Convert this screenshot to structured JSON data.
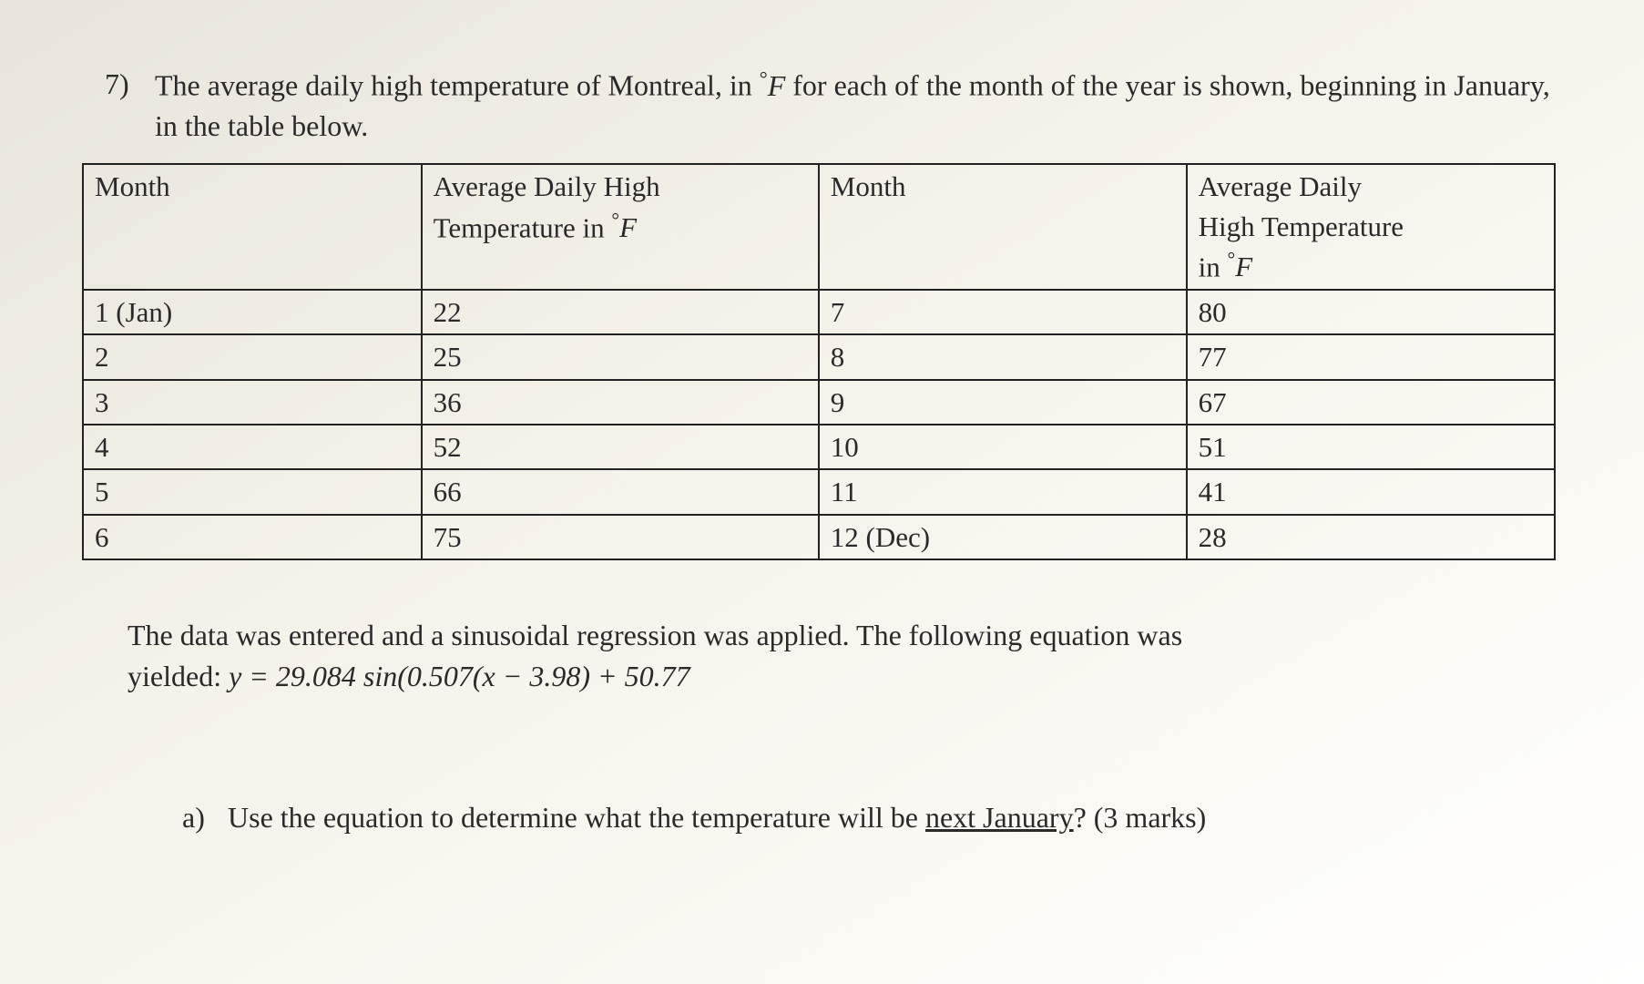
{
  "problem": {
    "number": "7)",
    "prompt_pre_unit": "The average daily high temperature of Montreal, in ",
    "unit_symbol": "°",
    "unit_letter": "F",
    "prompt_post_unit": " for each of the month of the year is shown, beginning in January, in the table below."
  },
  "table": {
    "headers": {
      "month1": "Month",
      "temp1_line1": "Average Daily High",
      "temp1_line2_pre": "Temperature in ",
      "temp1_unit_symbol": "°",
      "temp1_unit_letter": "F",
      "month2": "Month",
      "temp2_line1": "Average Daily",
      "temp2_line2": "High Temperature",
      "temp2_line3_pre": "in ",
      "temp2_unit_symbol": "°",
      "temp2_unit_letter": "F"
    },
    "rows": [
      {
        "m1": "1 (Jan)",
        "t1": "22",
        "m2": "7",
        "t2": "80"
      },
      {
        "m1": "2",
        "t1": "25",
        "m2": "8",
        "t2": "77"
      },
      {
        "m1": "3",
        "t1": "36",
        "m2": "9",
        "t2": "67"
      },
      {
        "m1": "4",
        "t1": "52",
        "m2": "10",
        "t2": "51"
      },
      {
        "m1": "5",
        "t1": "66",
        "m2": "11",
        "t2": "41"
      },
      {
        "m1": "6",
        "t1": "75",
        "m2": "12 (Dec)",
        "t2": "28"
      }
    ]
  },
  "regression": {
    "line1": "The data was entered and a sinusoidal regression was applied. The following equation was",
    "line2_prefix": "yielded:   ",
    "equation": "y = 29.084 sin(0.507(x − 3.98) + 50.77"
  },
  "subpart_a": {
    "label": "a)",
    "text_pre": "Use the equation to determine what the temperature will be ",
    "underlined": "next January",
    "text_post": "? (3 marks)"
  },
  "chart_data": {
    "type": "table",
    "title": "Average Daily High Temperature of Montreal (°F) by Month",
    "columns": [
      "Month",
      "Average Daily High Temperature (°F)"
    ],
    "rows": [
      [
        "1 (Jan)",
        22
      ],
      [
        "2",
        25
      ],
      [
        "3",
        36
      ],
      [
        "4",
        52
      ],
      [
        "5",
        66
      ],
      [
        "6",
        75
      ],
      [
        "7",
        80
      ],
      [
        "8",
        77
      ],
      [
        "9",
        67
      ],
      [
        "10",
        51
      ],
      [
        "11",
        41
      ],
      [
        "12 (Dec)",
        28
      ]
    ]
  }
}
